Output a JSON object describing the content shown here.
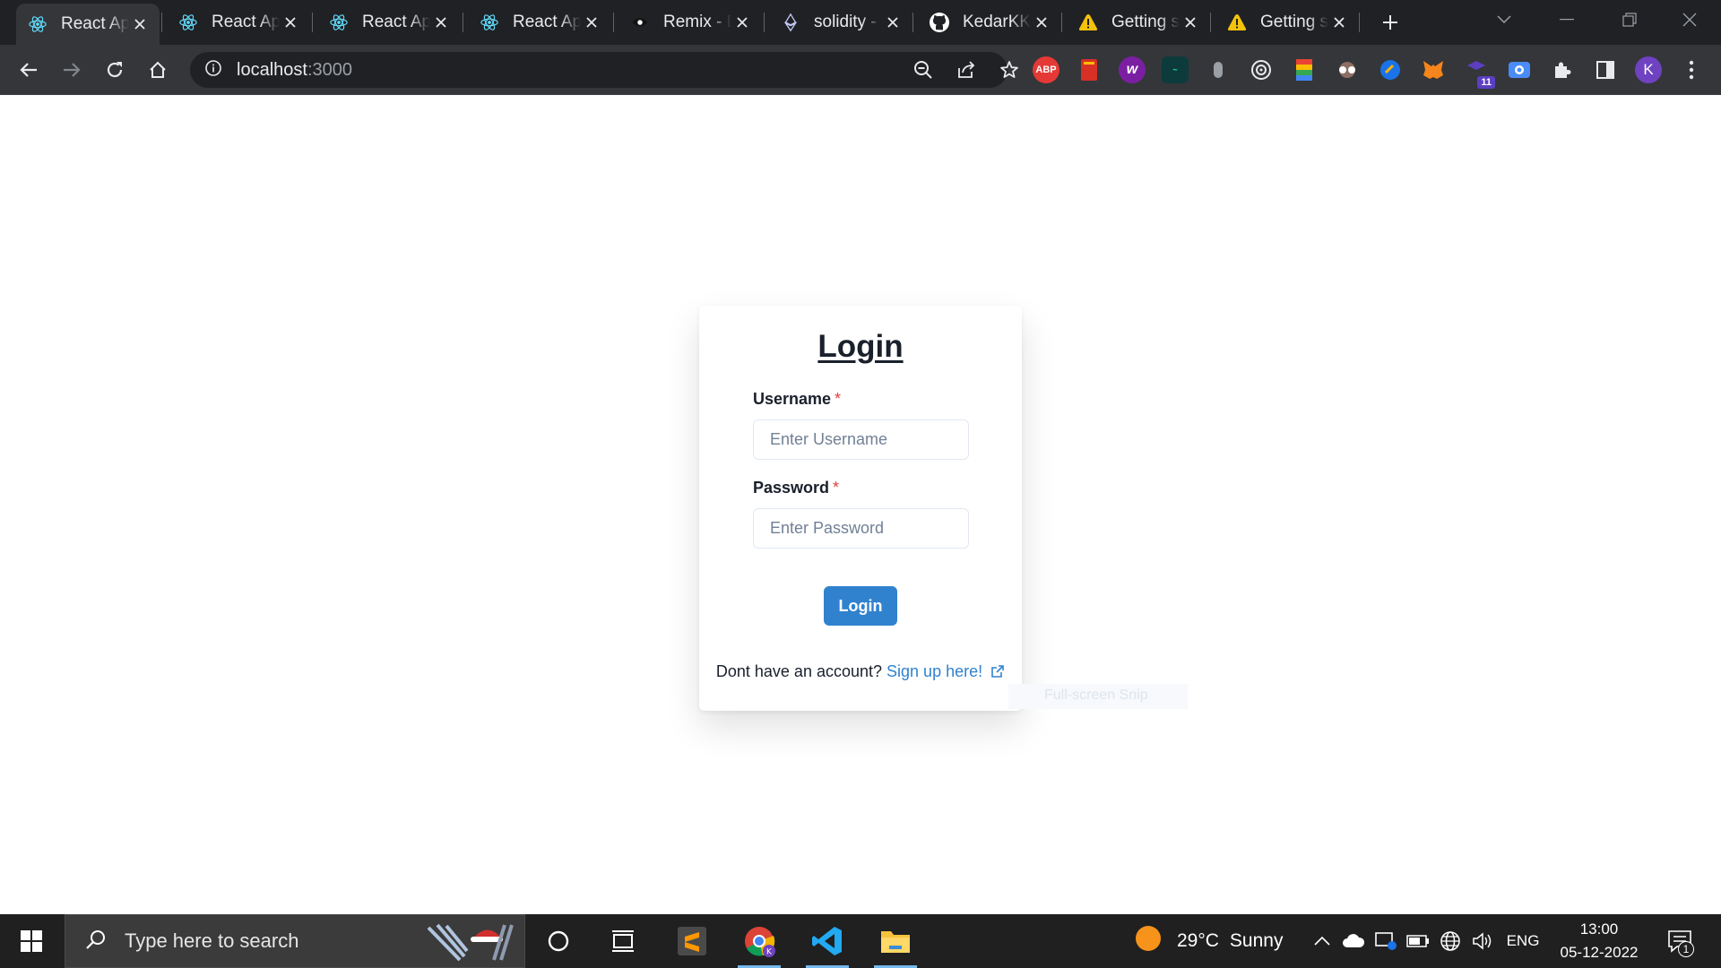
{
  "browser": {
    "tabs": [
      {
        "title": "React App",
        "icon": "react-icon",
        "active": true
      },
      {
        "title": "React App",
        "icon": "react-icon"
      },
      {
        "title": "React App",
        "icon": "react-icon"
      },
      {
        "title": "React App",
        "icon": "react-icon"
      },
      {
        "title": "Remix - Ethereum IDE",
        "icon": "remix-icon"
      },
      {
        "title": "solidity - ",
        "icon": "ethereum-icon"
      },
      {
        "title": "KedarKK",
        "icon": "github-icon"
      },
      {
        "title": "Getting started",
        "icon": "warning-icon"
      },
      {
        "title": "Getting started",
        "icon": "warning-icon"
      }
    ],
    "address": {
      "host": "localhost",
      "port": ":3000"
    },
    "profile_initial": "K",
    "extension_badge": "11",
    "abp_label": "ABP"
  },
  "login": {
    "title": "Login",
    "username_label": "Username",
    "username_placeholder": "Enter Username",
    "password_label": "Password",
    "password_placeholder": "Enter Password",
    "required_mark": "*",
    "button_label": "Login",
    "signup_prompt": "Dont have an account?",
    "signup_link": "Sign up here!",
    "snip_hint": "Full-screen Snip"
  },
  "colors": {
    "accent": "#3182ce",
    "required": "#e53e3e",
    "chrome_bg": "#202124",
    "toolbar_bg": "#35363a"
  },
  "taskbar": {
    "search_placeholder": "Type here to search",
    "weather": {
      "temp": "29°C",
      "condition": "Sunny"
    },
    "language": "ENG",
    "time": "13:00",
    "date": "05-12-2022",
    "notification_count": "1"
  }
}
